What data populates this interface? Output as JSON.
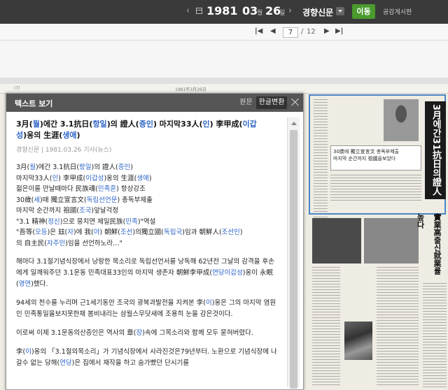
{
  "colors": {
    "topbar": "#3a3a3a",
    "go_button": "#4a9a2e",
    "highlight": "#2b63c7",
    "selection_border": "#4a86c5"
  },
  "nav": {
    "prev_icon": "chevron-left-icon",
    "calendar_icon": "calendar-icon",
    "year": "1981",
    "month": "03",
    "month_unit": "월",
    "day": "26",
    "day_unit": "일",
    "next_icon": "chevron-right-icon",
    "newspaper": "경향신문",
    "go_label": "이동",
    "board_label": "공감게시판"
  },
  "pager": {
    "first": "|◀",
    "prev": "◀",
    "current": "7",
    "sep": "/",
    "total": "12",
    "next": "▶",
    "last": "▶|"
  },
  "newspaper_page": {
    "strip_left": "(7)",
    "strip_mid": "1981年3月26日",
    "headline": "3月에간31抗日의證人",
    "subhead": "實業高출신就業률높다",
    "box1_line1": "30歲에 獨立宣言文 총독부제출",
    "box1_line2": "마지막 순간까지 祖國을보았다"
  },
  "panel": {
    "title": "텍스트 보기",
    "orig_label": "원문",
    "conv_label": "한글변환",
    "close_icon": "close-icon"
  },
  "article": {
    "title_a": "3月(",
    "title_b": "월",
    "title_c": ")에간 3.1抗日(",
    "title_d": "항일",
    "title_e": ")의 證人(",
    "title_f": "증인",
    "title_g": ") 마지막33人(",
    "title_h": "인",
    "title_i": ") 李甲成(",
    "title_j": "이갑",
    "title_k": "성",
    "title_l": ")옹의 生涯(",
    "title_m": "생애",
    "title_n": ")",
    "meta": "경향신문 | 1981.03.26 기사(뉴스)",
    "l1a": "3月(",
    "l1b": "월",
    "l1c": ")에간 3.1抗日(",
    "l1d": "항일",
    "l1e": ")의 證人(",
    "l1f": "증인",
    "l1g": ")",
    "l2a": "마지막33人(",
    "l2b": "인",
    "l2c": ") 李甲成(",
    "l2d": "이갑성",
    "l2e": ")옹의 生涯(",
    "l2f": "생애",
    "l2g": ")",
    "l3a": "젊은이를 만날때마다 民族魂(",
    "l3b": "민족혼",
    "l3c": ") 항상강조",
    "l4a": "30歲(",
    "l4b": "세",
    "l4c": ")때 獨立宣言文(",
    "l4d": "독립선언문",
    "l4e": ") 총독부제출",
    "l5a": "마지막 순간까지 祖國(",
    "l5b": "조국",
    "l5c": ")앞날걱정",
    "l6a": "\"3.1 精神(",
    "l6b": "정신",
    "l6c": ")으로 뭉치면 제일民族(",
    "l6d": "민족",
    "l6e": ")\"역설",
    "l7a": "\"吾等(",
    "l7b": "오등",
    "l7c": ")은 玆(",
    "l7d": "자",
    "l7e": ")에 我(",
    "l7f": "아",
    "l7g": ") 朝鮮(",
    "l7h": "조선",
    "l7i": ")의獨立國(",
    "l7j": "독립국",
    "l7k": ")임과 朝鮮人(",
    "l7l": "조선인",
    "l7m": ")",
    "l8a": "의 自主民(",
    "l8b": "자주민",
    "l8c": ")임을 선언하노라…\"",
    "p1a": " 해마다 3.1절기념식장에서 낭랑한 목소리로 독립선언서를 낭독해 62년전 그날의 감격을 후손에게 일깨워주던 3.1운동 민족대표33인의 마지막 생존자 朝鮮李甲成(",
    "p1b": "연당이갑성",
    "p1c": ")옹이 永眠(",
    "p1d": "영면",
    "p1e": ")했다.",
    "p2a": " 94세의 천수를 누리며 근1세기동안 조국의 광복과발전을 지켜본 李(",
    "p2b": "이",
    "p2c": ")옹은 그의 마지막 염원인 민족통일을보지못한채 봄비내리는 삼월스무닷새에 조용히 눈을 감은것이다.",
    "p3a": " 이로써 이제 3.1운동의산증인은 역사의 章(",
    "p3b": "장",
    "p3c": ")속에 그목소리와 함께 모두 묻혀버렸다.",
    "p4a": " 李(",
    "p4b": "이",
    "p4c": ")옹의 「3.1절의목소리」가 기념식장에서 사라진것은79년부터. 노환으로 기",
    "p4d": "념식장에 나갈수 없는 당해(",
    "p4e": "연당",
    "p4f": ")은 집에서 재작을 하고 숨가빴던 단시기를"
  }
}
